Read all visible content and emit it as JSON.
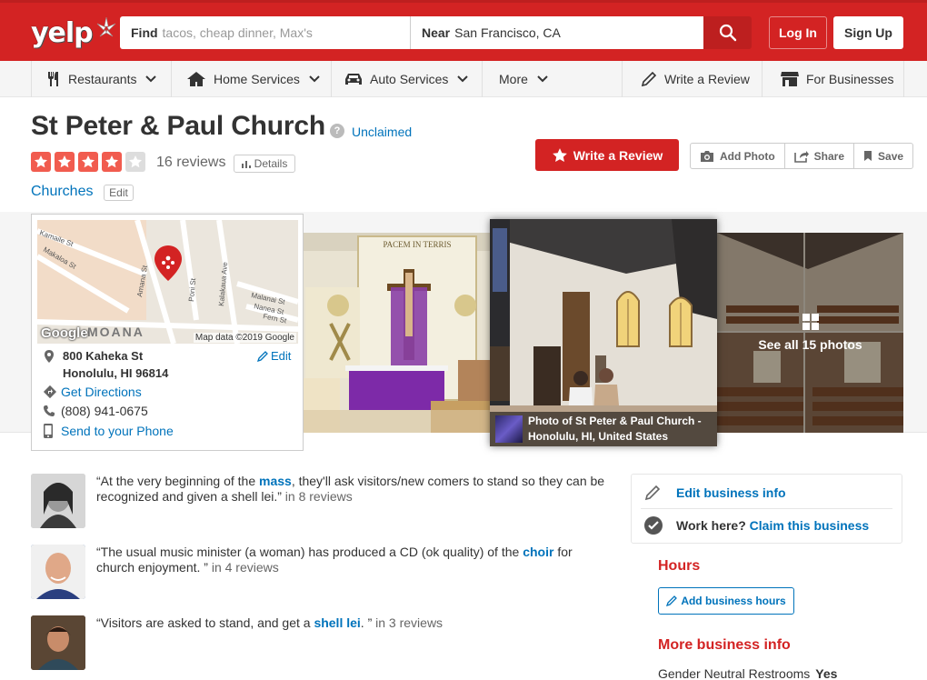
{
  "header": {
    "logo": "yelp",
    "search": {
      "find_label": "Find",
      "find_placeholder": "tacos, cheap dinner, Max's",
      "near_label": "Near",
      "near_value": "San Francisco, CA"
    },
    "login": "Log In",
    "signup": "Sign Up",
    "colors": {
      "brand": "#d32323",
      "link": "#0073bb"
    }
  },
  "subnav": {
    "items": [
      {
        "label": "Restaurants",
        "icon": "fork-knife-icon",
        "dropdown": true
      },
      {
        "label": "Home Services",
        "icon": "house-icon",
        "dropdown": true
      },
      {
        "label": "Auto Services",
        "icon": "car-icon",
        "dropdown": true
      },
      {
        "label": "More",
        "dropdown": true
      },
      {
        "label": "Write a Review",
        "icon": "pencil-icon"
      },
      {
        "label": "For Businesses",
        "icon": "storefront-icon"
      }
    ]
  },
  "business": {
    "name": "St Peter & Paul Church",
    "claim_status": "Unclaimed",
    "rating": 4,
    "rating_max": 5,
    "review_count": "16 reviews",
    "details_label": "Details",
    "category": "Churches",
    "edit_label": "Edit"
  },
  "actions": {
    "write_review": "Write a Review",
    "add_photo": "Add Photo",
    "share": "Share",
    "save": "Save"
  },
  "map": {
    "attribution": "Map data ©2019 Google",
    "google": "Google",
    "labels": [
      "Kamaile St",
      "Makaloa St",
      "Amana St",
      "Poni St",
      "Kalakaua Ave",
      "Malanai St",
      "Nanea St",
      "Fern St",
      "MOANA"
    ],
    "address_line1": "800 Kaheka St",
    "address_line2": "Honolulu, HI 96814",
    "edit": "Edit",
    "directions": "Get Directions",
    "phone": "(808) 941-0675",
    "send": "Send to your Phone"
  },
  "photos": {
    "caption_line1": "Photo of St Peter & Paul Church -",
    "caption_line2": "Honolulu, HI, United States",
    "altar_banner": "PACEM IN TERRIS",
    "see_all": "See all 15 photos"
  },
  "tips": [
    {
      "pre": "“At the very beginning of the ",
      "kw": "mass",
      "post": ", they'll ask visitors/new comers to stand so they can be recognized and given a shell lei.”",
      "count": " in 8 reviews"
    },
    {
      "pre": "“The usual music minister (a woman) has produced a CD (ok quality) of the ",
      "kw": "choir",
      "post": " for church enjoyment. ”",
      "count": " in 4 reviews"
    },
    {
      "pre": "“Visitors are asked to stand, and get a ",
      "kw": "shell lei",
      "post": ". ”",
      "count": " in 3 reviews"
    }
  ],
  "sidebar": {
    "edit_info": "Edit business info",
    "work_here": "Work here?",
    "claim": "Claim this business",
    "hours_title": "Hours",
    "add_hours": "Add business hours",
    "more_title": "More business info",
    "gender_neutral_label": "Gender Neutral Restrooms",
    "gender_neutral_value": "Yes"
  }
}
